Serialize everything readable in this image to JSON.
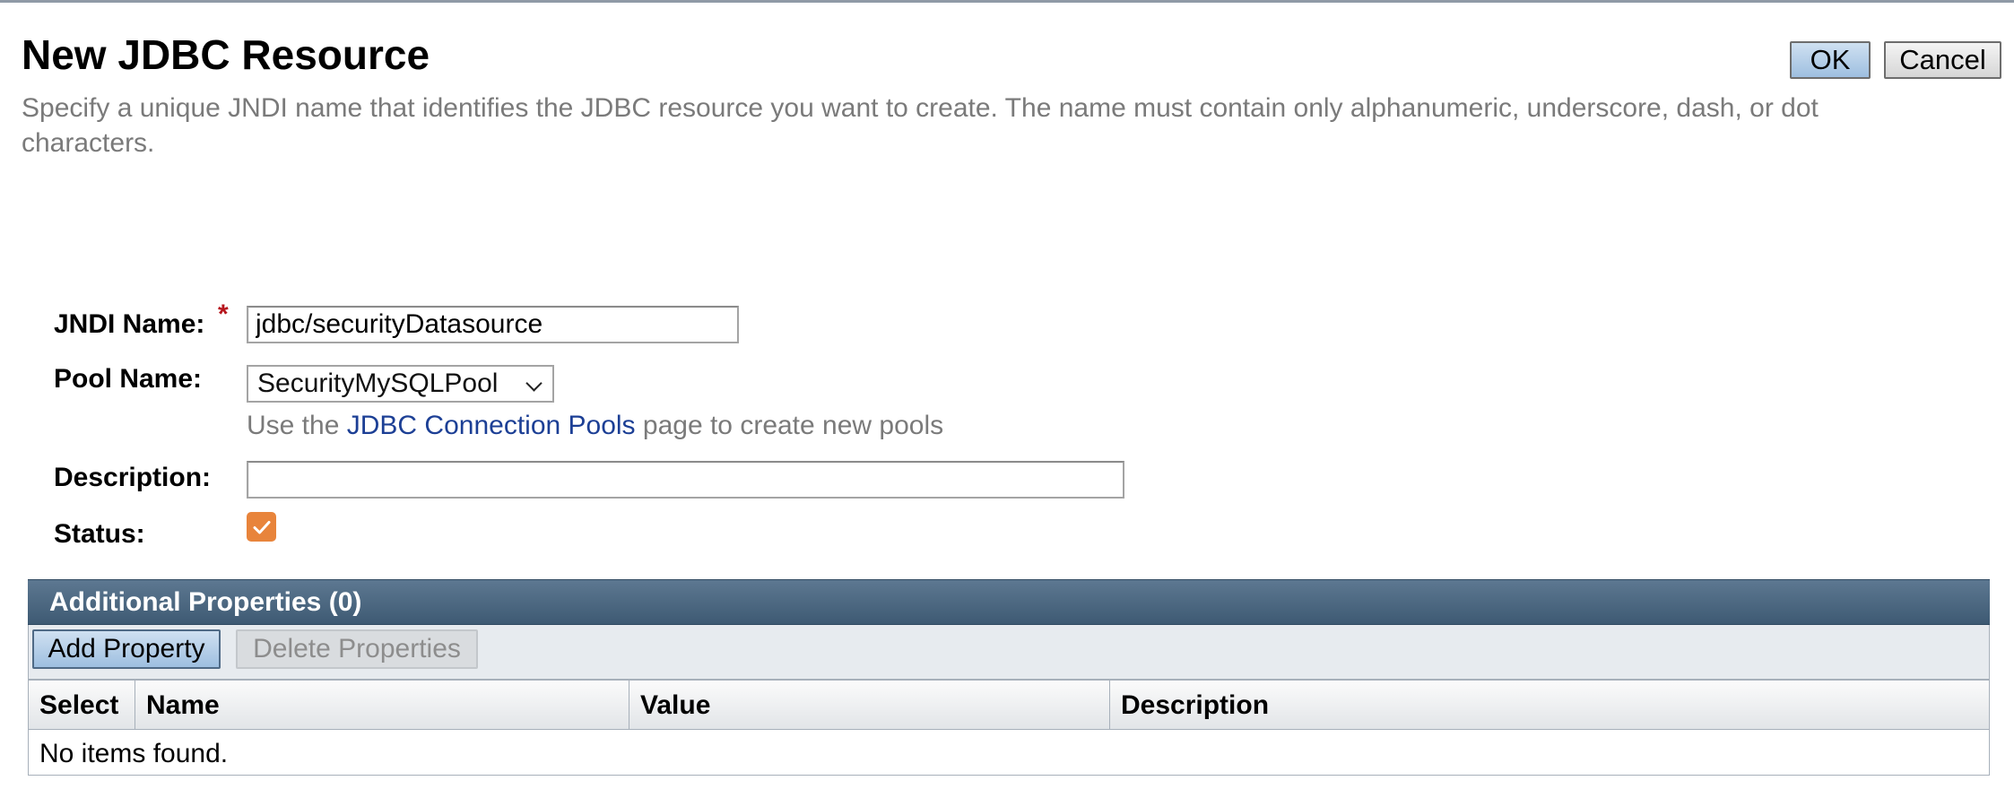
{
  "page": {
    "title": "New JDBC Resource",
    "description": "Specify a unique JNDI name that identifies the JDBC resource you want to create. The name must contain only alphanumeric, underscore, dash, or dot characters.",
    "ok_label": "OK",
    "cancel_label": "Cancel"
  },
  "form": {
    "jndi_label": "JNDI Name:",
    "required_marker": "*",
    "jndi_value": "jdbc/securityDatasource",
    "pool_label": "Pool Name:",
    "pool_selected": "SecurityMySQLPool",
    "hint_prefix": "Use the ",
    "hint_link": "JDBC Connection Pools",
    "hint_suffix": " page to create new pools",
    "description_label": "Description:",
    "description_value": "",
    "status_label": "Status:",
    "status_checked": true
  },
  "additional_properties": {
    "title": "Additional Properties (0)",
    "add_label": "Add Property",
    "delete_label": "Delete Properties",
    "columns": [
      "Select",
      "Name",
      "Value",
      "Description"
    ],
    "empty_text": "No items found."
  },
  "colors": {
    "accent": "#e8843b",
    "header_bar": "#4a6680",
    "link": "#1c3f95",
    "required": "#b6161d"
  },
  "icons": {
    "status_checkbox": "checkmark-icon",
    "pool_dropdown": "chevron-down-icon"
  }
}
